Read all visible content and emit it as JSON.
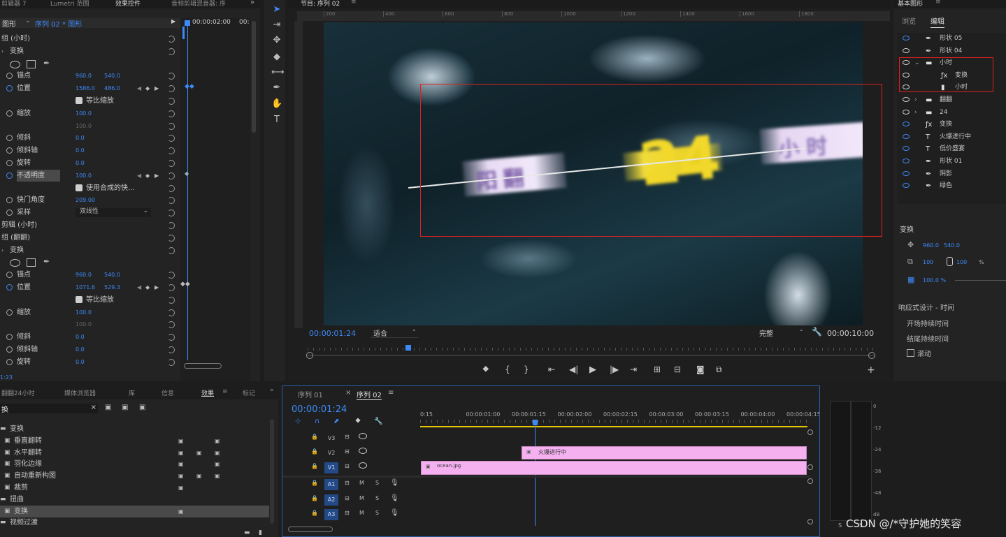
{
  "effects_controls": {
    "tabs": [
      "剪辑器 7",
      "Lumetri 范围",
      "效果控件",
      "音频剪辑混音器: 序"
    ],
    "clip_selector": "图形",
    "sequence_clip": "序列 02 * 图形",
    "timecode_head": "00:00:02:00",
    "timecode_tail": "00:",
    "rows": [
      {
        "label": "组 (小时)",
        "indent": 0
      },
      {
        "label": "变换",
        "indent": 1
      },
      {
        "label": "锚点",
        "v1": "960.0",
        "v2": "540.0"
      },
      {
        "label": "位置",
        "v1": "1586.0",
        "v2": "486.0",
        "key": true
      },
      {
        "label": "等比缩放",
        "check": true
      },
      {
        "label": "缩放",
        "v1": "100.0"
      },
      {
        "label": "",
        "v1": "100.0",
        "dim": true
      },
      {
        "label": "倾斜",
        "v1": "0.0"
      },
      {
        "label": "倾斜轴",
        "v1": "0.0"
      },
      {
        "label": "旋转",
        "v1": "0.0"
      },
      {
        "label": "不透明度",
        "v1": "100.0",
        "key": true,
        "hl": true
      },
      {
        "label": "使用合成的快...",
        "check": true
      },
      {
        "label": "快门角度",
        "v1": "209.00"
      },
      {
        "label": "采样",
        "select": "双线性"
      },
      {
        "label": "剪辑 (小时)",
        "indent": 0
      },
      {
        "label": "组 (翻翻)",
        "indent": 0
      },
      {
        "label": "变换",
        "indent": 1
      },
      {
        "label": "锚点",
        "v1": "960.0",
        "v2": "540.0"
      },
      {
        "label": "位置",
        "v1": "1071.6",
        "v2": "529.3",
        "key": true
      },
      {
        "label": "等比缩放",
        "check": true
      },
      {
        "label": "缩放",
        "v1": "100.0"
      },
      {
        "label": "",
        "v1": "100.0",
        "dim": true
      },
      {
        "label": "倾斜",
        "v1": "0.0"
      },
      {
        "label": "倾斜轴",
        "v1": "0.0"
      },
      {
        "label": "旋转",
        "v1": "0.0"
      }
    ],
    "footer_time": "1:23"
  },
  "program_monitor": {
    "title": "节目: 序列 02",
    "ruler_ticks": [
      "200",
      "400",
      "600",
      "800",
      "1000",
      "1200",
      "1400",
      "1600",
      "1800"
    ],
    "timecode": "00:00:01:24",
    "fit": "适合",
    "quality": "完整",
    "duration": "00:00:10:00",
    "frame_texts": [
      "阳翻",
      "24",
      "小时"
    ]
  },
  "essential_graphics": {
    "title": "基本图形",
    "tabs": [
      "浏览",
      "编辑"
    ],
    "layers": [
      {
        "name": "形状 05",
        "icon": "pen",
        "eye": "blue"
      },
      {
        "name": "形状 04",
        "icon": "pen",
        "eye": "white"
      },
      {
        "name": "小时",
        "icon": "folder",
        "eye": "white",
        "caret": true
      },
      {
        "name": "变换",
        "icon": "fx",
        "eye": "white",
        "indent": true
      },
      {
        "name": "小时",
        "icon": "clip",
        "eye": "white",
        "indent": true
      },
      {
        "name": "翻翻",
        "icon": "folder",
        "eye": "white",
        "caret": true
      },
      {
        "name": "24",
        "icon": "folder",
        "eye": "white",
        "caret": true
      },
      {
        "name": "变换",
        "icon": "fx",
        "eye": "blue"
      },
      {
        "name": "火爆进行中",
        "icon": "text",
        "eye": "blue"
      },
      {
        "name": "低价盛宴",
        "icon": "text",
        "eye": "blue"
      },
      {
        "name": "形状 01",
        "icon": "pen",
        "eye": "blue"
      },
      {
        "name": "阴影",
        "icon": "pen",
        "eye": "blue"
      },
      {
        "name": "绿色",
        "icon": "pen",
        "eye": "blue"
      }
    ],
    "transform_title": "变换",
    "pos_x": "960.0",
    "pos_y": "540.0",
    "scale_x": "100",
    "scale_y": "100",
    "percent": "%",
    "opacity": "100.0 %",
    "responsive_title": "响应式设计 - 时间",
    "intro_dur": "开场持续时间",
    "outro_dur": "结尾持续时间",
    "scroll": "滚动"
  },
  "effects_panel": {
    "tabs": [
      "翻翻24小时",
      "媒体浏览器",
      "库",
      "信息",
      "效果",
      "标记"
    ],
    "search_value": "换",
    "items": [
      {
        "label": "变换",
        "type": "folder",
        "indent": 0
      },
      {
        "label": "垂直翻转",
        "type": "fx",
        "indent": 1
      },
      {
        "label": "水平翻转",
        "type": "fx",
        "indent": 1
      },
      {
        "label": "羽化边缘",
        "type": "fx",
        "indent": 1
      },
      {
        "label": "自动重新构图",
        "type": "fx",
        "indent": 1
      },
      {
        "label": "裁剪",
        "type": "fx",
        "indent": 1
      },
      {
        "label": "扭曲",
        "type": "folder",
        "indent": 0
      },
      {
        "label": "变换",
        "type": "fx",
        "indent": 1,
        "selected": true
      },
      {
        "label": "视频过渡",
        "type": "folder",
        "indent": 0
      }
    ]
  },
  "timeline": {
    "tabs": [
      "序列 01",
      "序列 02"
    ],
    "timecode": "00:00:01:24",
    "ruler": [
      "0:15",
      "00:00:01:00",
      "00:00:01:15",
      "00:00:02:00",
      "00:00:02:15",
      "00:00:03:00",
      "00:00:03:15",
      "00:00:04:00",
      "00:00:04:15"
    ],
    "video_tracks": [
      "V3",
      "V2",
      "V1"
    ],
    "audio_tracks": [
      "A1",
      "A2",
      "A3"
    ],
    "clip_v2": "火爆进行中",
    "clip_v1": "ocean.jpg",
    "m_label": "M",
    "s_label": "S"
  },
  "meter": {
    "scale": [
      "0",
      "-12",
      "-24",
      "-36",
      "-48",
      "dB"
    ],
    "s_labels": [
      "S",
      "S"
    ]
  },
  "watermark": "CSDN @/*守护她的笑容",
  "colors": {
    "accent": "#3d8af7",
    "clip_pink": "#f5b0f0",
    "highlight_red": "#e02020",
    "playhead_yellow": "#e5c400"
  }
}
